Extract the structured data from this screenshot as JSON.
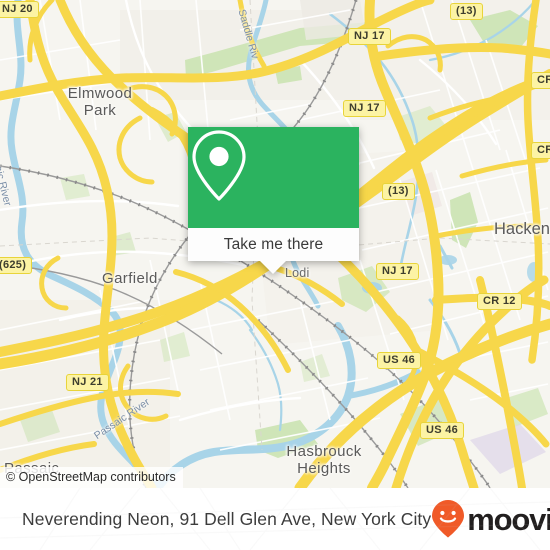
{
  "map": {
    "attribution": "© OpenStreetMap contributors",
    "background_color": "#f6f5f0",
    "places": [
      {
        "name": "Elmwood Park",
        "line1": "Elmwood",
        "line2": "Park"
      },
      {
        "name": "Garfield",
        "label": "Garfield"
      },
      {
        "name": "Lodi",
        "label": "Lodi"
      },
      {
        "name": "Hackensack",
        "label": "Hacken"
      },
      {
        "name": "Hasbrouck Heights",
        "line1": "Hasbrouck",
        "line2": "Heights"
      },
      {
        "name": "Passaic",
        "label": "Passaic"
      }
    ],
    "rivers": [
      {
        "label": "Passaic River"
      },
      {
        "label": "Saddle Riv"
      },
      {
        "label": "Passaic River"
      }
    ],
    "shields": [
      {
        "label": "NJ 20"
      },
      {
        "label": "NJ 17"
      },
      {
        "label": "NJ 17"
      },
      {
        "label": "NJ 17"
      },
      {
        "label": "(13)"
      },
      {
        "label": "(13)"
      },
      {
        "label": "CR"
      },
      {
        "label": "CR"
      },
      {
        "label": "CR 12"
      },
      {
        "label": "(625)"
      },
      {
        "label": "NJ 21"
      },
      {
        "label": "US 46"
      },
      {
        "label": "US 46"
      }
    ]
  },
  "popup": {
    "action_label": "Take me there",
    "accent_color": "#2bb35f",
    "marker_icon": "map-pin-icon"
  },
  "bottom_bar": {
    "title": "Neverending Neon, 91 Dell Glen Ave, New York City",
    "brand_name": "moovit",
    "brand_color": "#f05a28",
    "brand_icon": "moovit-smiley-pin-icon"
  }
}
